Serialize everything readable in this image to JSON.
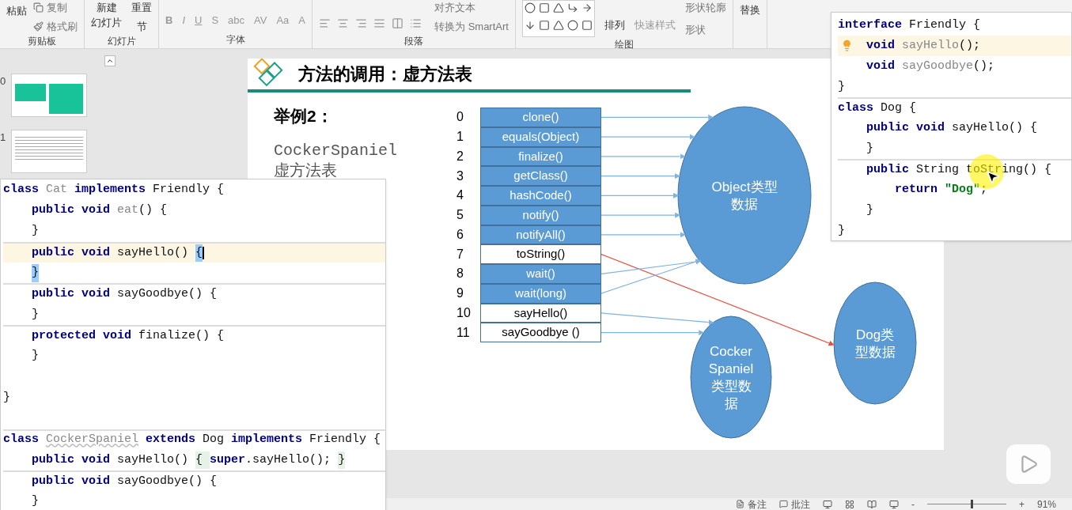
{
  "ribbon": {
    "groups": [
      {
        "kind": "clipboard",
        "label": "剪贴板",
        "items": [
          "粘贴",
          "复制",
          "格式刷"
        ]
      },
      {
        "kind": "slides",
        "label": "幻灯片",
        "items": [
          "新建",
          "幻灯片",
          "重置",
          "节"
        ]
      },
      {
        "kind": "font",
        "label": "字体",
        "items": [
          "B",
          "I",
          "U",
          "S",
          "abc",
          "AV",
          "Aa",
          "A"
        ]
      },
      {
        "kind": "paragraph",
        "label": "段落",
        "items": [
          "对齐文本",
          "转换为 SmartArt"
        ]
      },
      {
        "kind": "drawing",
        "label": "绘图",
        "items": [
          "排列",
          "快速样式",
          "形状轮廓",
          "形状"
        ]
      },
      {
        "kind": "editing",
        "items": [
          "替换"
        ]
      }
    ]
  },
  "thumbnails": [
    {
      "number": "0",
      "kind": "cards"
    },
    {
      "number": "1",
      "kind": "text"
    }
  ],
  "slide": {
    "title": "方法的调用：虚方法表",
    "heading": "举例2：",
    "caption": "CockerSpaniel",
    "caption_2": "虚方法表",
    "ellipses": [
      {
        "kind": "object",
        "label_lines": [
          "Object类型",
          "数据"
        ]
      },
      {
        "kind": "dog",
        "label_lines": [
          "Dog类",
          "型数据"
        ]
      },
      {
        "kind": "cocker",
        "label_lines": [
          "Cocker",
          "Spaniel",
          "类型数",
          "据"
        ]
      }
    ],
    "methods": [
      {
        "index": "0",
        "name": "clone()",
        "highlighted": true,
        "kind": "object"
      },
      {
        "index": "1",
        "name": "equals(Object)",
        "highlighted": true,
        "kind": "object"
      },
      {
        "index": "2",
        "name": "finalize()",
        "highlighted": true,
        "kind": "object"
      },
      {
        "index": "3",
        "name": "getClass()",
        "highlighted": true,
        "kind": "object"
      },
      {
        "index": "4",
        "name": "hashCode()",
        "highlighted": true,
        "kind": "object"
      },
      {
        "index": "5",
        "name": "notify()",
        "highlighted": true,
        "kind": "object"
      },
      {
        "index": "6",
        "name": "notifyAll()",
        "highlighted": true,
        "kind": "object"
      },
      {
        "index": "7",
        "name": "toString()",
        "highlighted": false,
        "kind": "dog"
      },
      {
        "index": "8",
        "name": "wait()",
        "highlighted": true,
        "kind": "object"
      },
      {
        "index": "9",
        "name": "wait(long)",
        "highlighted": true,
        "kind": "object"
      },
      {
        "index": "10",
        "name": "sayHello()",
        "highlighted": false,
        "kind": "cocker"
      },
      {
        "index": "11",
        "name": "sayGoodbye ()",
        "highlighted": false,
        "kind": "cocker"
      }
    ]
  },
  "code_left": {
    "lines": [
      {
        "gap_before": false,
        "indented": false,
        "divider": false,
        "highlighted": false,
        "cursor": false,
        "tokens": [
          {
            "kind": "kw",
            "text": "class "
          },
          {
            "kind": "dim",
            "text": "Cat "
          },
          {
            "kind": "kw",
            "text": "implements "
          },
          {
            "kind": "plain",
            "text": "Friendly {"
          }
        ]
      },
      {
        "gap_before": false,
        "indented": true,
        "divider": false,
        "highlighted": false,
        "cursor": false,
        "tokens": [
          {
            "kind": "kw",
            "text": "public void "
          },
          {
            "kind": "dim",
            "text": "eat"
          },
          {
            "kind": "plain",
            "text": "() {"
          }
        ]
      },
      {
        "gap_before": false,
        "indented": true,
        "divider": false,
        "highlighted": false,
        "cursor": false,
        "tokens": [
          {
            "kind": "plain",
            "text": "}"
          }
        ]
      },
      {
        "gap_before": false,
        "indented": true,
        "divider": true,
        "highlighted": true,
        "cursor": true,
        "tokens": [
          {
            "kind": "kw",
            "text": "public void "
          },
          {
            "kind": "plain",
            "text": "sayHello() "
          },
          {
            "kind": "match",
            "text": "{"
          }
        ]
      },
      {
        "gap_before": false,
        "indented": true,
        "divider": false,
        "highlighted": false,
        "cursor": false,
        "tokens": [
          {
            "kind": "match",
            "text": "}"
          }
        ]
      },
      {
        "gap_before": false,
        "indented": true,
        "divider": true,
        "highlighted": false,
        "cursor": false,
        "tokens": [
          {
            "kind": "kw",
            "text": "public void "
          },
          {
            "kind": "plain",
            "text": "sayGoodbye() {"
          }
        ]
      },
      {
        "gap_before": false,
        "indented": true,
        "divider": false,
        "highlighted": false,
        "cursor": false,
        "tokens": [
          {
            "kind": "plain",
            "text": "}"
          }
        ]
      },
      {
        "gap_before": false,
        "indented": true,
        "divider": true,
        "highlighted": false,
        "cursor": false,
        "tokens": [
          {
            "kind": "kw",
            "text": "protected void "
          },
          {
            "kind": "plain",
            "text": "finalize() {"
          }
        ]
      },
      {
        "gap_before": false,
        "indented": true,
        "divider": false,
        "highlighted": false,
        "cursor": false,
        "tokens": [
          {
            "kind": "plain",
            "text": "}"
          }
        ]
      },
      {
        "gap_before": true,
        "indented": false,
        "divider": false,
        "highlighted": false,
        "cursor": false,
        "tokens": [
          {
            "kind": "plain",
            "text": "}"
          }
        ]
      },
      {
        "gap_before": true,
        "indented": false,
        "divider": true,
        "highlighted": false,
        "cursor": false,
        "tokens": [
          {
            "kind": "kw",
            "text": "class "
          },
          {
            "kind": "warn",
            "text": "CockerSpaniel"
          },
          {
            "kind": "kw",
            "text": " extends "
          },
          {
            "kind": "plain",
            "text": "Dog "
          },
          {
            "kind": "kw",
            "text": "implements "
          },
          {
            "kind": "plain",
            "text": "Friendly {"
          }
        ]
      },
      {
        "gap_before": false,
        "indented": true,
        "divider": false,
        "highlighted": false,
        "cursor": false,
        "tokens": [
          {
            "kind": "kw",
            "text": "public void "
          },
          {
            "kind": "plain",
            "text": "sayHello() "
          },
          {
            "kind": "fold",
            "text": "{ "
          },
          {
            "kind": "kw",
            "text": "super"
          },
          {
            "kind": "plain",
            "text": ".sayHello(); "
          },
          {
            "kind": "fold",
            "text": "}"
          }
        ]
      },
      {
        "gap_before": false,
        "indented": true,
        "divider": true,
        "highlighted": false,
        "cursor": false,
        "tokens": [
          {
            "kind": "kw",
            "text": "public void "
          },
          {
            "kind": "plain",
            "text": "sayGoodbye() {"
          }
        ]
      },
      {
        "gap_before": false,
        "indented": true,
        "divider": false,
        "highlighted": false,
        "cursor": false,
        "tokens": [
          {
            "kind": "plain",
            "text": "}"
          }
        ]
      }
    ]
  },
  "code_right": {
    "lines": [
      {
        "indented": false,
        "divider": false,
        "highlighted": false,
        "cursor": false,
        "tokens": [
          {
            "kind": "kw",
            "text": "interface "
          },
          {
            "kind": "plain",
            "text": "Friendly {"
          }
        ]
      },
      {
        "indented": true,
        "divider": false,
        "highlighted": true,
        "cursor": false,
        "tokens": [
          {
            "kind": "kw",
            "text": "void "
          },
          {
            "kind": "dim",
            "text": "sayHello"
          },
          {
            "kind": "plain",
            "text": "();"
          }
        ]
      },
      {
        "indented": true,
        "divider": false,
        "highlighted": false,
        "cursor": false,
        "tokens": [
          {
            "kind": "kw",
            "text": "void "
          },
          {
            "kind": "dim",
            "text": "sayGoodbye"
          },
          {
            "kind": "plain",
            "text": "();"
          }
        ]
      },
      {
        "indented": false,
        "divider": false,
        "highlighted": false,
        "cursor": false,
        "tokens": [
          {
            "kind": "plain",
            "text": "}"
          }
        ]
      },
      {
        "indented": false,
        "divider": true,
        "highlighted": false,
        "cursor": false,
        "tokens": [
          {
            "kind": "kw",
            "text": "class "
          },
          {
            "kind": "plain",
            "text": "Dog {"
          }
        ]
      },
      {
        "indented": true,
        "divider": false,
        "highlighted": false,
        "cursor": false,
        "tokens": [
          {
            "kind": "kw",
            "text": "public void "
          },
          {
            "kind": "plain",
            "text": "sayHello() {"
          }
        ]
      },
      {
        "indented": true,
        "divider": false,
        "highlighted": false,
        "cursor": false,
        "tokens": [
          {
            "kind": "plain",
            "text": "}"
          }
        ]
      },
      {
        "indented": true,
        "divider": true,
        "highlighted": false,
        "cursor": false,
        "tokens": [
          {
            "kind": "kw",
            "text": "public "
          },
          {
            "kind": "plain",
            "text": "String toString() {"
          }
        ]
      },
      {
        "indented": true,
        "divider": false,
        "highlighted": false,
        "cursor": false,
        "tokens": [
          {
            "kind": "kw",
            "text": "    return "
          },
          {
            "kind": "str",
            "text": "\"Dog\""
          },
          {
            "kind": "plain",
            "text": ";"
          }
        ]
      },
      {
        "indented": true,
        "divider": false,
        "highlighted": false,
        "cursor": false,
        "tokens": [
          {
            "kind": "plain",
            "text": "}"
          }
        ]
      },
      {
        "indented": false,
        "divider": false,
        "highlighted": false,
        "cursor": false,
        "tokens": [
          {
            "kind": "plain",
            "text": "}"
          }
        ]
      }
    ]
  },
  "status_bar": {
    "notes": "备注",
    "comments": "批注",
    "zoom_out": "-",
    "zoom_in": "+",
    "zoom": "91%",
    "level": 0.55
  }
}
